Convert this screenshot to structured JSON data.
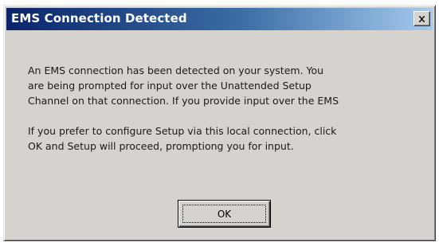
{
  "dialog": {
    "title": "EMS Connection Detected",
    "close_icon": "close-x-icon",
    "message_lines_1": [
      "An EMS connection has been detected on your system. You",
      "are being prompted for input over the Unattended Setup",
      "Channel on that connection. If you provide input over the EMS"
    ],
    "message_lines_2": [
      "If you prefer to configure Setup via this local connection, click",
      "OK and Setup will proceed, promptiong you for input."
    ],
    "ok_label": "OK"
  },
  "colors": {
    "titlebar_start": "#0a246a",
    "titlebar_end": "#a6caf0",
    "window_face": "#d6d3ce"
  }
}
